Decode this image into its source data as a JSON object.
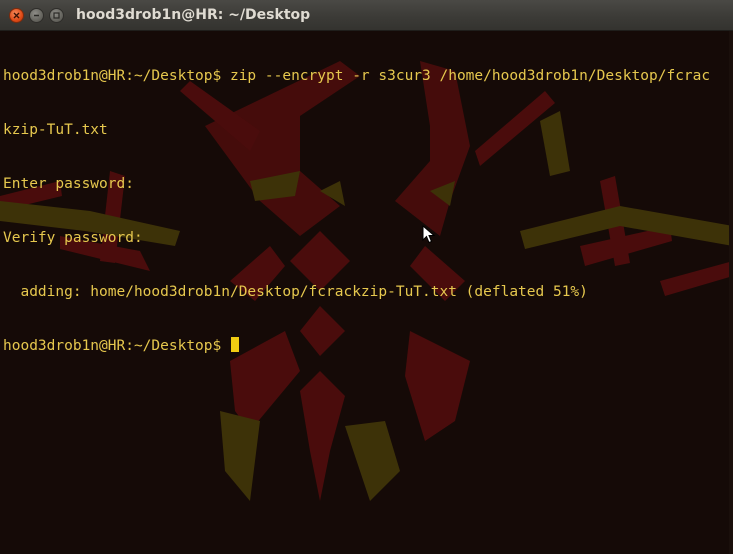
{
  "window": {
    "title": "hood3drob1n@HR: ~/Desktop",
    "buttons": {
      "close": "close-icon",
      "minimize": "minimize-icon",
      "maximize": "maximize-icon"
    }
  },
  "terminal": {
    "lines": [
      "hood3drob1n@HR:~/Desktop$ zip --encrypt -r s3cur3 /home/hood3drob1n/Desktop/fcrac",
      "kzip-TuT.txt",
      "Enter password:",
      "Verify password:",
      "  adding: home/hood3drob1n/Desktop/fcrackzip-TuT.txt (deflated 51%)",
      "hood3drob1n@HR:~/Desktop$ "
    ]
  },
  "colors": {
    "text": "#e6c84e",
    "cursor": "#f0cc12",
    "background": "#150a07",
    "wallpaper_red": "#4a0c0c",
    "wallpaper_gold": "#3d3208"
  }
}
